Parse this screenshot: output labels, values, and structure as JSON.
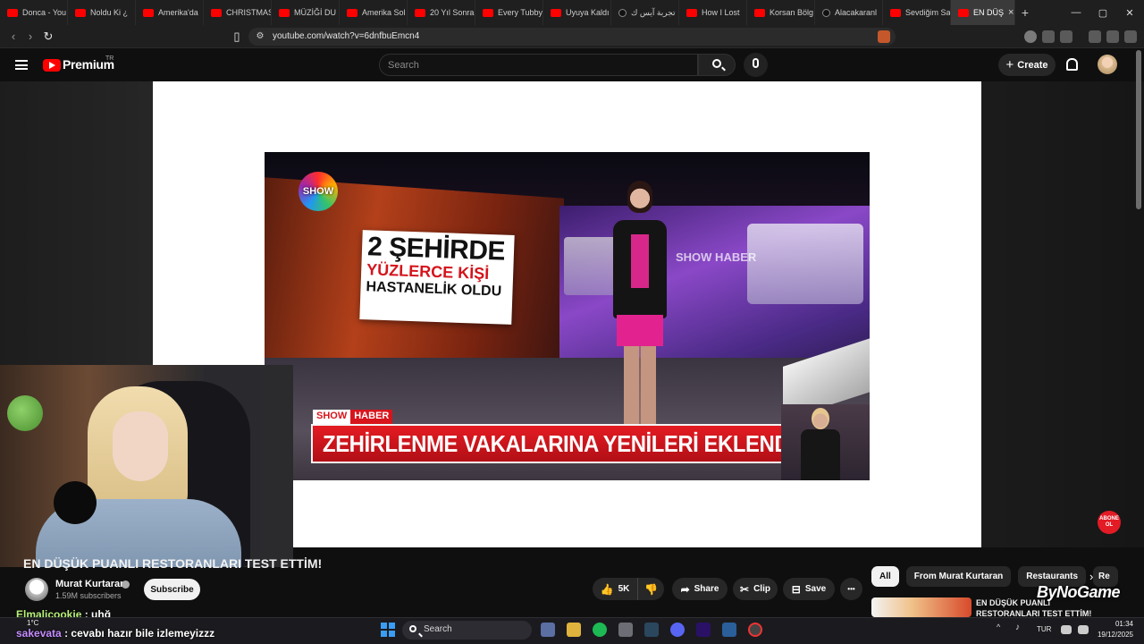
{
  "browser": {
    "tabs": [
      {
        "label": "Donca - You",
        "icon": "youtube-favicon"
      },
      {
        "label": "Noldu Ki ¿",
        "icon": "youtube-favicon"
      },
      {
        "label": "Amerika'da",
        "icon": "youtube-favicon"
      },
      {
        "label": "CHRISTMAS",
        "icon": "youtube-favicon"
      },
      {
        "label": "MÜZİĞİ DU",
        "icon": "youtube-favicon"
      },
      {
        "label": "Amerika Sol",
        "icon": "youtube-favicon"
      },
      {
        "label": "20 Yıl Sonra",
        "icon": "youtube-favicon"
      },
      {
        "label": "Every Tubby",
        "icon": "youtube-favicon"
      },
      {
        "label": "Uyuya Kaldı",
        "icon": "youtube-favicon"
      },
      {
        "label": "تجربة آيس ك",
        "icon": "tiktok-favicon"
      },
      {
        "label": "How I Lost",
        "icon": "youtube-favicon"
      },
      {
        "label": "Korsan Bölg",
        "icon": "youtube-favicon"
      },
      {
        "label": "Alacakaranl",
        "icon": "tiktok-favicon"
      },
      {
        "label": "Sevdiğim Sa",
        "icon": "youtube-favicon"
      }
    ],
    "active_tab": {
      "label": "EN DÜŞ",
      "close": "×"
    },
    "new_tab": "+",
    "window_controls": {
      "minimize": "—",
      "maximize": "▢",
      "close": "✕"
    },
    "url": "youtube.com/watch?v=6dnfbuEmcn4"
  },
  "youtube_header": {
    "logo_text": "Premium",
    "country": "TR",
    "search_placeholder": "Search",
    "create_label": "Create",
    "create_icon": "+"
  },
  "video": {
    "channel_logo": "SHOW",
    "headline_line1": "2 ŞEHİRDE",
    "headline_line2": "YÜZLERCE KİŞİ",
    "headline_line3": "HASTANELİK OLDU",
    "wall_brand": "SHOW HABER",
    "lower_tag_show": "SHOW",
    "lower_tag_haber": "HABER",
    "lower_third": "ZEHİRLENME VAKALARINA YENİLERİ EKLENDİ",
    "subscribe_badge_line1": "ABONE",
    "subscribe_badge_line2": "OL"
  },
  "below_video": {
    "title": "EN DÜŞÜK PUANLI RESTORANLARI TEST ETTİM!",
    "channel": "Murat Kurtaran",
    "subscribers": "1.59M subscribers",
    "subscribe": "Subscribe",
    "like_count": "5K",
    "share": "Share",
    "clip": "Clip",
    "save": "Save",
    "more": "•••"
  },
  "sidebar": {
    "chips": [
      "All",
      "From Murat Kurtaran",
      "Restaurants",
      "Re"
    ],
    "next_icon": "›",
    "rec_title": "EN DÜŞÜK PUANLI RESTORANLARI TEST ETTİM!",
    "sponsor": "ByNoGame"
  },
  "chat": [
    {
      "user": "Elmalicookie",
      "message": ": uhğ"
    },
    {
      "user": "sakevata",
      "message": ": cevabı hazır bile izlemeyizzz"
    }
  ],
  "taskbar": {
    "search_label": "Search",
    "weather": "1°C",
    "language": "TUR",
    "time": "01:34",
    "date": "19/12/2025"
  },
  "colors": {
    "youtube_red": "#ff0000",
    "show_red": "#d7141c",
    "background": "#0f0f0f"
  }
}
